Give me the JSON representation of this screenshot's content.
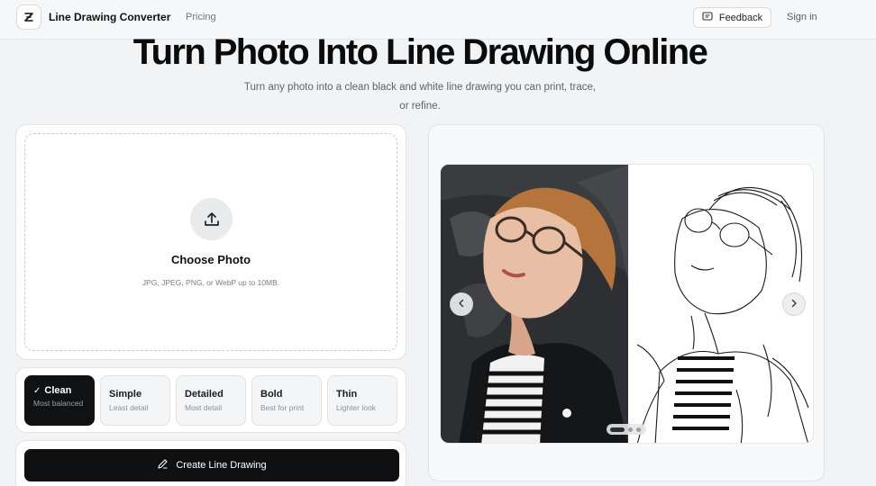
{
  "header": {
    "brand": "Line Drawing Converter",
    "nav": {
      "pricing": "Pricing"
    },
    "feedback_label": "Feedback",
    "signin_label": "Sign in"
  },
  "hero": {
    "title": "Turn Photo Into Line Drawing Online",
    "subtitle": "Turn any photo into a clean black and white line drawing you can print, trace, or refine."
  },
  "upload": {
    "title": "Choose Photo",
    "hint": "JPG, JPEG, PNG, or WebP up to 10MB."
  },
  "styles": [
    {
      "name": "Clean",
      "desc": "Most balanced",
      "active": true
    },
    {
      "name": "Simple",
      "desc": "Least detail",
      "active": false
    },
    {
      "name": "Detailed",
      "desc": "Most detail",
      "active": false
    },
    {
      "name": "Bold",
      "desc": "Best for print",
      "active": false
    },
    {
      "name": "Thin",
      "desc": "Lighter look",
      "active": false
    }
  ],
  "create_button": "Create Line Drawing",
  "preview": {
    "slide_count": 3,
    "active_slide": 1
  },
  "colors": {
    "primary": "#0f1012",
    "background": "#f1f3f5",
    "border": "#e1e3e6",
    "muted_text": "#5d636b"
  },
  "icons": [
    "logo-icon",
    "feedback-icon",
    "upload-icon",
    "check-icon",
    "pencil-icon",
    "chevron-left-icon",
    "chevron-right-icon"
  ]
}
